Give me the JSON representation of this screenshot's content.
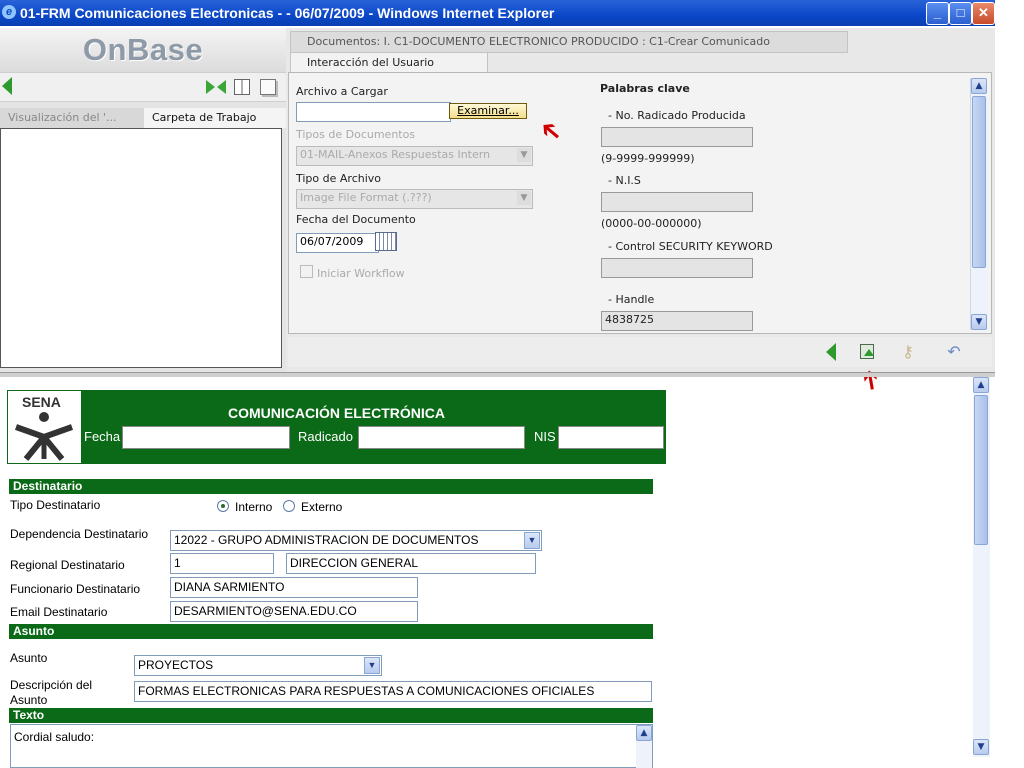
{
  "window": {
    "title": "01-FRM Comunicaciones Electronicas - - 06/07/2009 - Windows Internet Explorer",
    "controls": {
      "minimize": "_",
      "maximize": "□",
      "close": "✕"
    }
  },
  "left_panel": {
    "logo": "OnBase",
    "tabs": [
      {
        "label": "Visualización del '..."
      },
      {
        "label": "Carpeta de Trabajo"
      }
    ]
  },
  "document_tabs": [
    {
      "label": "Documentos: I. C1-DOCUMENTO ELECTRONICO PRODUCIDO : C1-Crear Comunicado"
    },
    {
      "label": "Interacción del Usuario"
    }
  ],
  "upload_form": {
    "archivo_label": "Archivo a Cargar",
    "archivo_value": "",
    "examinar_label": "Examinar...",
    "tipos_documentos_label": "Tipos de Documentos",
    "tipos_documentos_value": "01-MAIL-Anexos Respuestas Intern",
    "tipo_archivo_label": "Tipo de Archivo",
    "tipo_archivo_value": "Image File Format (.???)",
    "fecha_label": "Fecha del Documento",
    "fecha_value": "06/07/2009",
    "workflow_label": "Iniciar Workflow"
  },
  "keywords": {
    "title": "Palabras clave",
    "fields": [
      {
        "label": "- No. Radicado Producida",
        "value": "",
        "hint": "(9-9999-999999)"
      },
      {
        "label": "- N.I.S",
        "value": "",
        "hint": "(0000-00-000000)"
      },
      {
        "label": "- Control SECURITY KEYWORD",
        "value": ""
      },
      {
        "label": "- Handle",
        "value": "4838725"
      }
    ]
  },
  "form": {
    "title": "COMUNICACIÓN ELECTRÓNICA",
    "logo_text": "SENA",
    "fecha_label": "Fecha",
    "radicado_label": "Radicado",
    "nis_label": "NIS",
    "section_destinatario": "Destinatario",
    "tipo_destinatario_label": "Tipo Destinatario",
    "interno_label": "Interno",
    "externo_label": "Externo",
    "dependencia_label": "Dependencia Destinatario",
    "dependencia_value": "12022 - GRUPO ADMINISTRACION DE DOCUMENTOS",
    "regional_label": "Regional Destinatario",
    "regional_code": "1",
    "regional_name": "DIRECCION GENERAL",
    "funcionario_label": "Funcionario Destinatario",
    "funcionario_value": "DIANA SARMIENTO",
    "email_label": "Email Destinatario",
    "email_value": "DESARMIENTO@SENA.EDU.CO",
    "section_asunto": "Asunto",
    "asunto_label": "Asunto",
    "asunto_value": "PROYECTOS",
    "descripcion_label_1": "Descripción del",
    "descripcion_label_2": "Asunto",
    "descripcion_value": "FORMAS ELECTRONICAS PARA RESPUESTAS A COMUNICACIONES OFICIALES",
    "section_texto": "Texto",
    "texto_value": "Cordial saludo:"
  },
  "colors": {
    "green": "#0b6a17",
    "title_bar": "#0b47c8",
    "arrow": "#d10000"
  }
}
